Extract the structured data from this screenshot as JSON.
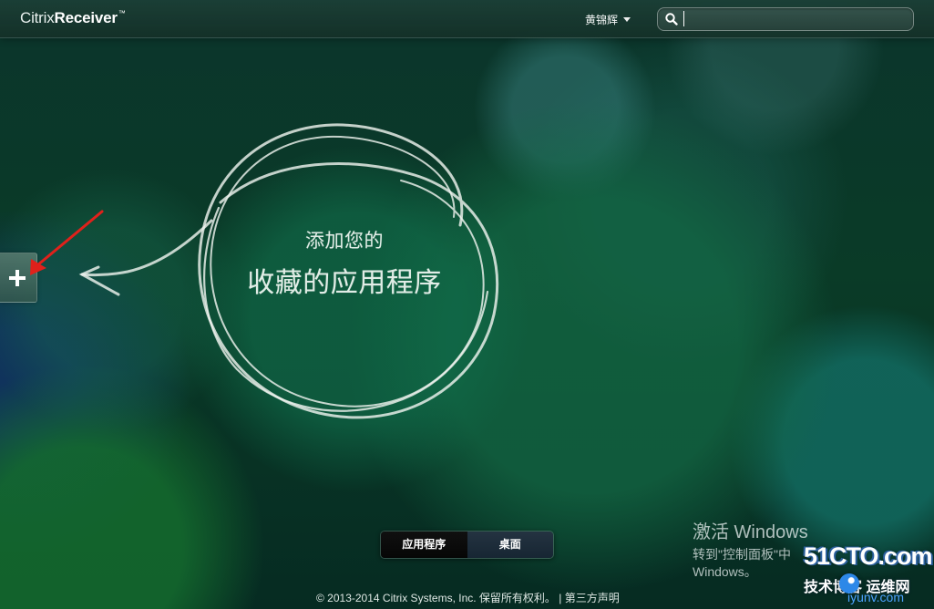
{
  "app": {
    "brand_light": "Citrix",
    "brand_bold": "Receiver",
    "brand_tm": "™"
  },
  "header": {
    "user_name": "黄锦辉",
    "search": {
      "value": "",
      "placeholder": ""
    }
  },
  "icons": {
    "search": "search-icon",
    "add": "plus-icon",
    "user_menu": "chevron-down-icon",
    "annotation": "red-arrow-icon"
  },
  "hint": {
    "line1": "添加您的",
    "line2": "收藏的应用程序"
  },
  "tabs": [
    {
      "label": "应用程序",
      "active": true
    },
    {
      "label": "桌面",
      "active": false
    }
  ],
  "footer": {
    "copyright": "© 2013-2014 Citrix Systems, Inc. 保留所有权利。",
    "separator": "|",
    "third_party": "第三方声明"
  },
  "activation": {
    "title": "激活 Windows",
    "line2": "转到\"控制面板\"中",
    "line3": "Windows。"
  },
  "watermark": {
    "main": "51CTO.com",
    "sub": "技术博客",
    "extra": "运维网",
    "site": "iyunv.com"
  },
  "colors": {
    "background": "#0a3b27",
    "annotation_red": "#e0211b",
    "chalk": "#eef3ee",
    "tab_active": "#0b0b0b",
    "tab_inactive": "#1d2d3b"
  }
}
